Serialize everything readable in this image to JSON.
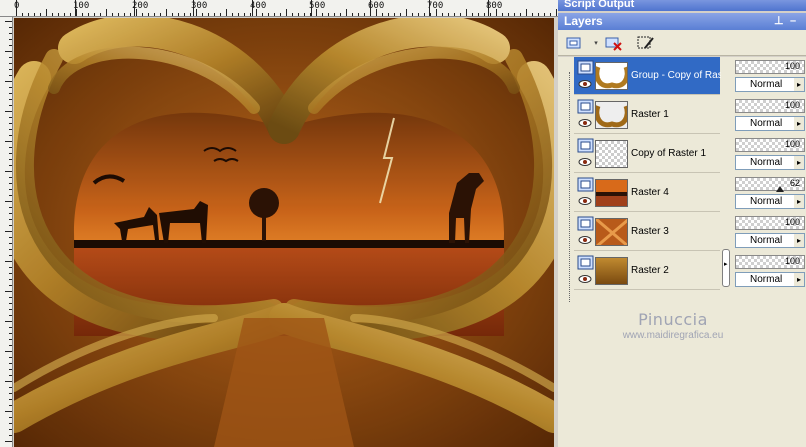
{
  "script_output": {
    "title": "Script Output"
  },
  "layers_panel": {
    "title": "Layers",
    "pin_glyph": "⊥",
    "close_glyph": "–",
    "layers": [
      {
        "name": "Group - Copy of Raster 1",
        "opacity": "100",
        "blend": "Normal",
        "selected": true,
        "thumb": "frame"
      },
      {
        "name": "Raster 1",
        "opacity": "100",
        "blend": "Normal",
        "selected": false,
        "thumb": "frame"
      },
      {
        "name": "Copy of Raster 1",
        "opacity": "100",
        "blend": "Normal",
        "selected": false,
        "thumb": "transparent"
      },
      {
        "name": "Raster 4",
        "opacity": "62",
        "blend": "Normal",
        "selected": false,
        "thumb": "landscape"
      },
      {
        "name": "Raster 3",
        "opacity": "100",
        "blend": "Normal",
        "selected": false,
        "thumb": "burst"
      },
      {
        "name": "Raster 2",
        "opacity": "100",
        "blend": "Normal",
        "selected": false,
        "thumb": "gradient"
      }
    ]
  },
  "rulers": {
    "top_labels": [
      "0",
      "100",
      "200",
      "300",
      "400",
      "500",
      "600",
      "700",
      "800"
    ]
  },
  "watermark": {
    "name": "Pinuccia",
    "url": "www.maidiregrafica.eu"
  },
  "colors": {
    "selection": "#316ac5",
    "panel_bg": "#ece9d8",
    "titlebar": "#5a7fd4",
    "gold": "#c49a3a",
    "sunset": "#e07820"
  }
}
